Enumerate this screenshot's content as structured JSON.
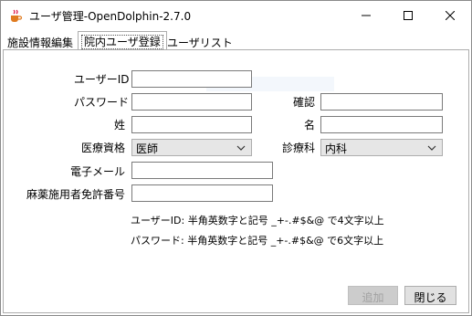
{
  "window": {
    "title": "ユーザ管理-OpenDolphin-2.7.0"
  },
  "tabs": [
    {
      "label": "施設情報編集"
    },
    {
      "label": "院内ユーザ登録"
    },
    {
      "label": "ユーザリスト"
    }
  ],
  "form": {
    "user_id_label": "ユーザーID",
    "user_id_value": "",
    "password_label": "パスワード",
    "password_value": "",
    "confirm_label": "確認",
    "confirm_value": "",
    "last_name_label": "姓",
    "last_name_value": "",
    "first_name_label": "名",
    "first_name_value": "",
    "license_label": "医療資格",
    "license_value": "医師",
    "dept_label": "診療科",
    "dept_value": "内科",
    "email_label": "電子メール",
    "email_value": "",
    "narcotic_label": "麻薬施用者免許番号",
    "narcotic_value": ""
  },
  "hints": {
    "user_id_hint": "ユーザーID: 半角英数字と記号 _+-.#$&@ で4文字以上",
    "password_hint": "パスワード: 半角英数字と記号 _+-.#$&@ で6文字以上"
  },
  "buttons": {
    "add_label": "追加",
    "close_label": "閉じる"
  },
  "colors": {
    "disabled_button": "#cccccc",
    "button": "#e1e1e1",
    "combo_bg": "#e6e6e6"
  },
  "icons": {
    "app": "java-cup-icon",
    "minimize": "minimize-icon",
    "maximize": "maximize-icon",
    "close": "close-icon",
    "dropdown": "chevron-down-icon"
  }
}
